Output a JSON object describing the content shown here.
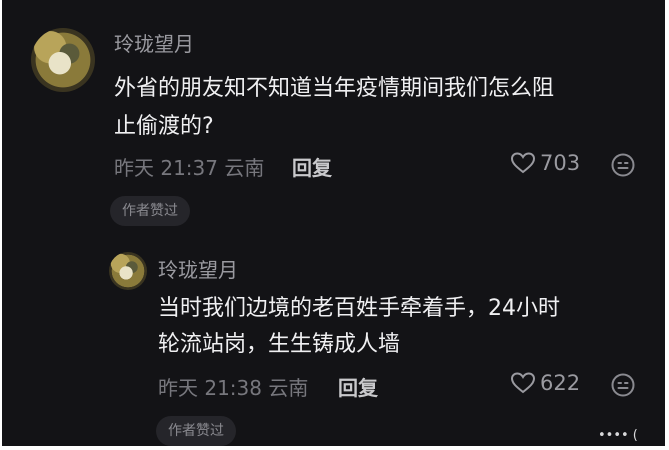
{
  "comments": [
    {
      "username": "玲珑望月",
      "text_line1": "外省的朋友知不知道当年疫情期间我们怎么阻",
      "text_line2": "止偷渡的?",
      "time_location": "昨天 21:37 云南",
      "reply_label": "回复",
      "likes": "703",
      "badge": "作者赞过"
    },
    {
      "username": "玲珑望月",
      "text_line1": "当时我们边境的老百姓手牵着手，24小时",
      "text_line2": "轮流站岗，生生铸成人墙",
      "time_location": "昨天 21:38 云南",
      "reply_label": "回复",
      "likes": "622",
      "badge": "作者赞过"
    }
  ],
  "corner_mark": "•••• (",
  "icons": {
    "like": "heart-outline-icon",
    "emoji": "emoji-smile-icon"
  },
  "colors": {
    "background": "#131316",
    "text": "#f0f0f2",
    "muted": "#77777d"
  }
}
